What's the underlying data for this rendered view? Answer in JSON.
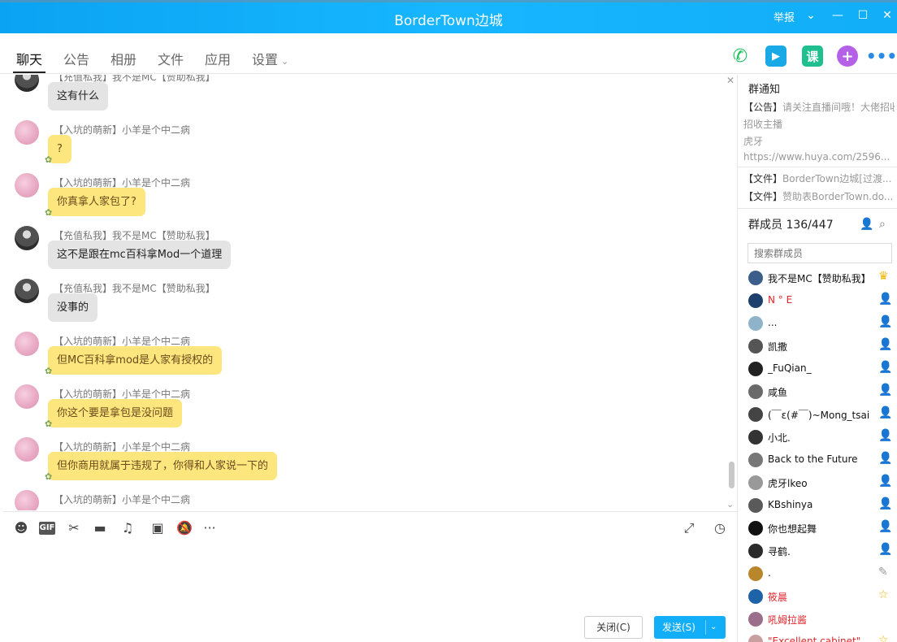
{
  "window": {
    "title": "BorderTown边城",
    "report_label": "举报"
  },
  "tabs": [
    {
      "label": "聊天"
    },
    {
      "label": "公告"
    },
    {
      "label": "相册"
    },
    {
      "label": "文件"
    },
    {
      "label": "应用"
    },
    {
      "label": "设置"
    }
  ],
  "actions": {
    "class_label": "课"
  },
  "messages": [
    {
      "sender": "【充值私我】我不是MC【赞助私我】",
      "text": "这有什么",
      "style": "gray"
    },
    {
      "sender": "【入坑的萌新】小羊是个中二病",
      "text": "?",
      "style": "yellow"
    },
    {
      "sender": "【入坑的萌新】小羊是个中二病",
      "text": "你真拿人家包了?",
      "style": "yellow"
    },
    {
      "sender": "【充值私我】我不是MC【赞助私我】",
      "text": "这不是跟在mc百科拿Mod一个道理",
      "style": "gray"
    },
    {
      "sender": "【充值私我】我不是MC【赞助私我】",
      "text": "没事的",
      "style": "gray"
    },
    {
      "sender": "【入坑的萌新】小羊是个中二病",
      "text": "但MC百科拿mod是人家有授权的",
      "style": "yellow"
    },
    {
      "sender": "【入坑的萌新】小羊是个中二病",
      "text": "你这个要是拿包是没问题",
      "style": "yellow"
    },
    {
      "sender": "【入坑的萌新】小羊是个中二病",
      "text": "但你商用就属于违规了，你得和人家说一下的",
      "style": "yellow"
    },
    {
      "sender": "【入坑的萌新】小羊是个中二病",
      "text": "",
      "style": "yellow"
    }
  ],
  "composer": {
    "close_label": "关闭(C)",
    "send_label": "发送(S)"
  },
  "notice": {
    "title": "群通知",
    "announce_tag": "【公告】",
    "announce_text": "请关注直播间哦！大佬招收主播",
    "announce_line2": "招收主播",
    "announce_line3": "虎牙",
    "announce_url": "https://www.huya.com/2596...",
    "file1_tag": "【文件】",
    "file1": "BorderTown边城[过渡...",
    "file2_tag": "【文件】",
    "file2": "赞助表BorderTown.do..."
  },
  "members": {
    "title": "群成员 136/447",
    "search_placeholder": "搜索群成员",
    "list": [
      {
        "name": "我不是MC【赞助私我】",
        "red": false,
        "role": "owner"
      },
      {
        "name": "N ° E",
        "red": true,
        "role": "admin"
      },
      {
        "name": "...",
        "red": false,
        "role": "member"
      },
      {
        "name": "凯撒",
        "red": false,
        "role": "member"
      },
      {
        "name": "_FuQian_",
        "red": false,
        "role": "member"
      },
      {
        "name": "咸鱼",
        "red": false,
        "role": "member"
      },
      {
        "name": "(￣ε(#￣)~Mong_tsai",
        "red": false,
        "role": "member"
      },
      {
        "name": "小北.",
        "red": false,
        "role": "admin"
      },
      {
        "name": "Back to the Future",
        "red": false,
        "role": "member"
      },
      {
        "name": "虎牙lkeo",
        "red": false,
        "role": "member"
      },
      {
        "name": "KBshinya",
        "red": false,
        "role": "member"
      },
      {
        "name": "你也想起舞",
        "red": false,
        "role": "admin"
      },
      {
        "name": "寻鹤.",
        "red": false,
        "role": "member"
      },
      {
        "name": ".",
        "red": false,
        "role": "edit"
      },
      {
        "name": "筱晨",
        "red": true,
        "role": "star"
      },
      {
        "name": "吼姆拉酱",
        "red": true,
        "role": "none"
      },
      {
        "name": "\"Excellent cabinet\"",
        "red": true,
        "role": "star"
      }
    ]
  }
}
